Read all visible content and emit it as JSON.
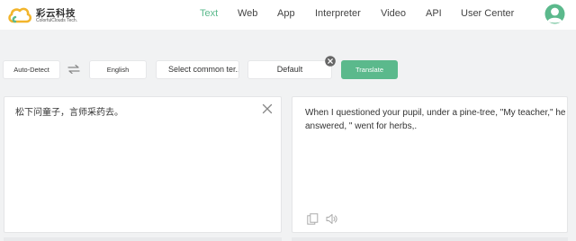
{
  "brand": {
    "name_cn": "彩云科技",
    "name_en": "ColorfulClouds Tech."
  },
  "nav": {
    "items": [
      "Text",
      "Web",
      "App",
      "Interpreter",
      "Video",
      "API",
      "User Center"
    ],
    "active": "Text"
  },
  "controls": {
    "source_language": "Auto-Detect",
    "target_language": "English",
    "terms_label": "Select common ter...",
    "model_label": "Default",
    "translate_label": "Translate"
  },
  "source": {
    "text": "松下问童子，言师采药去。"
  },
  "result": {
    "text": "When I questioned your pupil, under a pine-tree, \"My teacher,\" he answered, \" went for herbs,."
  },
  "colors": {
    "accent": "#5bb98c",
    "background": "#f1f2f3",
    "panel": "#ffffff"
  },
  "icons": {
    "swap": "swap-arrows-icon",
    "clear": "close-icon",
    "copy": "copy-icon",
    "speaker": "speaker-icon",
    "model_remove": "close-circle-icon"
  }
}
